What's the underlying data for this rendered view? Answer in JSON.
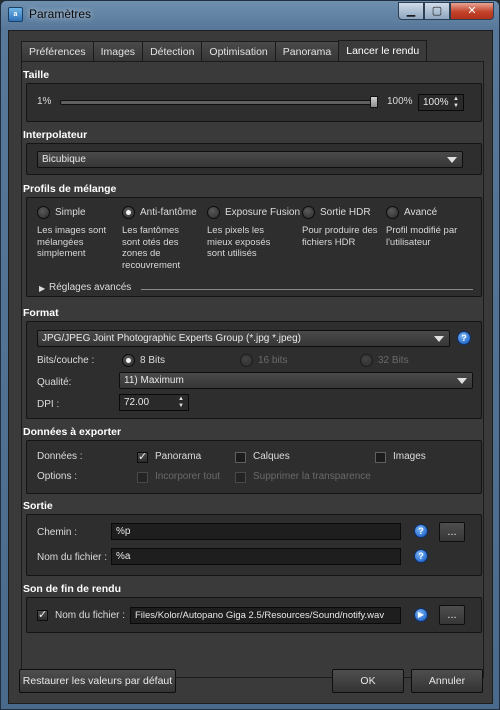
{
  "window": {
    "title": "Paramètres",
    "app_icon": "app-icon",
    "min_icon": "minimize-icon",
    "max_icon": "maximize-icon",
    "close_icon": "close-icon"
  },
  "tabs": [
    {
      "label": "Préférences"
    },
    {
      "label": "Images"
    },
    {
      "label": "Détection"
    },
    {
      "label": "Optimisation"
    },
    {
      "label": "Panorama"
    },
    {
      "label": "Lancer le rendu",
      "active": true
    }
  ],
  "size": {
    "title": "Taille",
    "min_label": "1%",
    "max_label": "100%",
    "value": "100%",
    "slider_value": 1.0
  },
  "interpolator": {
    "title": "Interpolateur",
    "value": "Bicubique"
  },
  "blend": {
    "title": "Profils de mélange",
    "options": [
      {
        "label": "Simple",
        "desc": "Les images sont mélangées simplement",
        "selected": false
      },
      {
        "label": "Anti-fantôme",
        "desc": "Les fantômes sont otés des zones de recouvrement",
        "selected": true
      },
      {
        "label": "Exposure Fusion",
        "desc": "Les pixels les mieux exposés sont utilisés",
        "selected": false
      },
      {
        "label": "Sortie HDR",
        "desc": "Pour produire des fichiers HDR",
        "selected": false
      },
      {
        "label": "Avancé",
        "desc": "Profil modifié par l'utilisateur",
        "selected": false
      }
    ],
    "advanced": "Réglages avancés"
  },
  "format": {
    "title": "Format",
    "value": "JPG/JPEG Joint Photographic Experts Group (*.jpg *.jpeg)",
    "bits_label": "Bits/couche :",
    "bits": [
      "8 Bits",
      "16 bits",
      "32 Bits"
    ],
    "quality_label": "Qualité:",
    "quality": "11) Maximum",
    "dpi_label": "DPI :",
    "dpi": "72.00"
  },
  "export": {
    "title": "Données à exporter",
    "data_label": "Données :",
    "data": [
      {
        "label": "Panorama",
        "checked": true
      },
      {
        "label": "Calques",
        "checked": false
      },
      {
        "label": "Images",
        "checked": false
      }
    ],
    "options_label": "Options :",
    "options": [
      {
        "label": "Incorporer tout"
      },
      {
        "label": "Supprimer la transparence"
      }
    ]
  },
  "output": {
    "title": "Sortie",
    "path_label": "Chemin :",
    "path": "%p",
    "filename_label": "Nom du fichier :",
    "filename": "%a",
    "browse": "..."
  },
  "sound": {
    "title": "Son de fin de rendu",
    "filename_label": "Nom du fichier :",
    "filename": "Files/Kolor/Autopano Giga 2.5/Resources/Sound/notify.wav",
    "browse": "..."
  },
  "buttons": {
    "restore": "Restaurer les valeurs par défaut",
    "ok": "OK",
    "cancel": "Annuler"
  },
  "colors": {
    "background": "#3a3a3a",
    "group": "#2e2e2e",
    "accent": "#2a6fd0",
    "titlebar": "#58789a"
  }
}
